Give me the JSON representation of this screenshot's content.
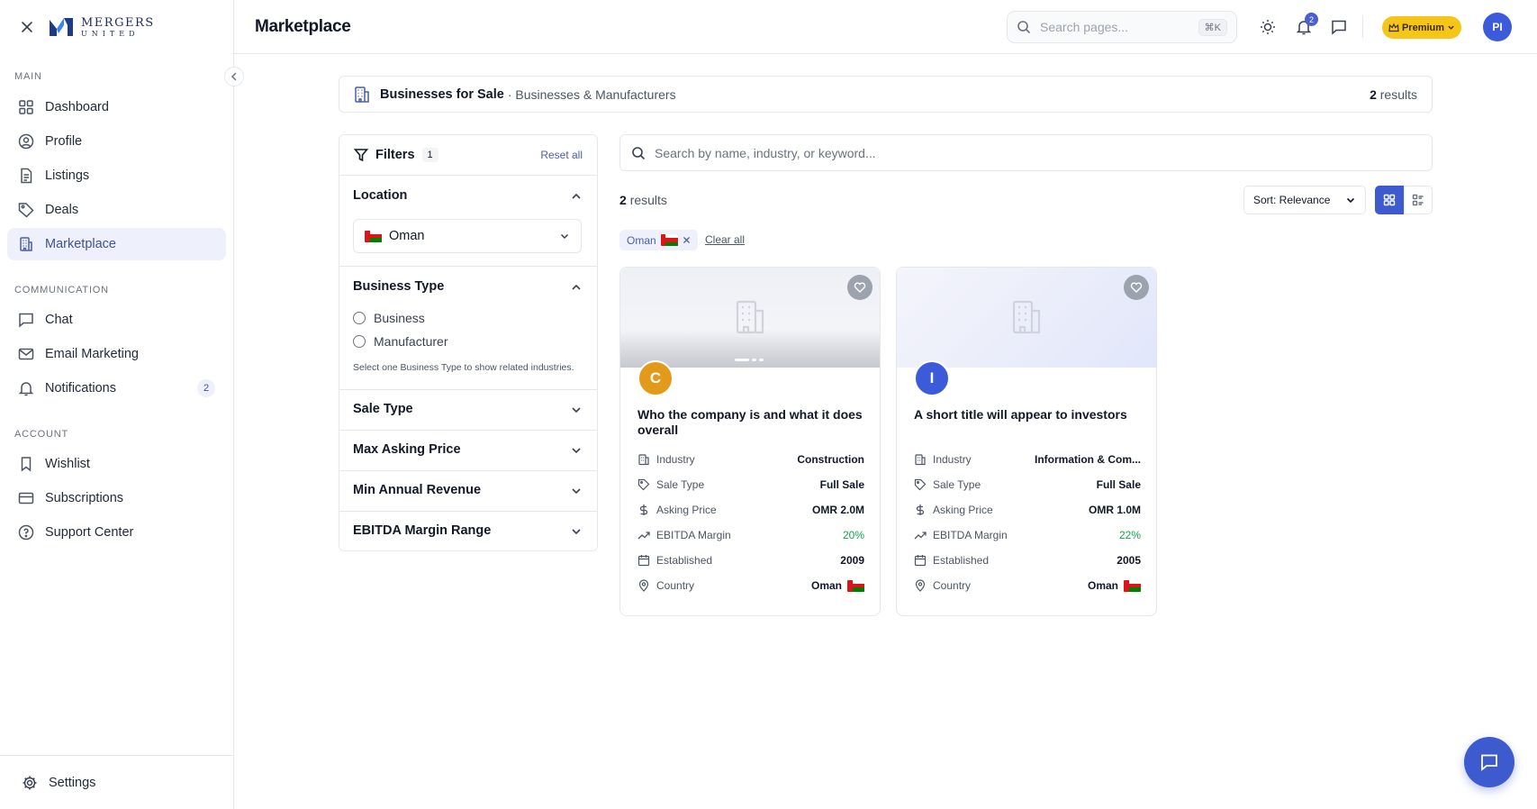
{
  "app": {
    "logo_line1": "MERGERS",
    "logo_line2": "UNITED"
  },
  "sidebar": {
    "sections": {
      "main": "MAIN",
      "communication": "COMMUNICATION",
      "account": "ACCOUNT"
    },
    "items": [
      {
        "label": "Dashboard",
        "icon": "grid-icon"
      },
      {
        "label": "Profile",
        "icon": "user-circle-icon"
      },
      {
        "label": "Listings",
        "icon": "document-icon"
      },
      {
        "label": "Deals",
        "icon": "tag-icon"
      },
      {
        "label": "Marketplace",
        "icon": "building-icon",
        "active": true
      },
      {
        "label": "Chat",
        "icon": "message-icon"
      },
      {
        "label": "Email Marketing",
        "icon": "mail-icon"
      },
      {
        "label": "Notifications",
        "icon": "bell-icon",
        "badge": "2"
      },
      {
        "label": "Wishlist",
        "icon": "bookmark-icon"
      },
      {
        "label": "Subscriptions",
        "icon": "credit-card-icon"
      },
      {
        "label": "Support Center",
        "icon": "help-circle-icon"
      }
    ],
    "footer_label": "Settings"
  },
  "topbar": {
    "title": "Marketplace",
    "search_placeholder": "Search pages...",
    "search_shortcut": "⌘K",
    "notification_count": "2",
    "premium_label": "Premium",
    "avatar_initials": "PI"
  },
  "header_card": {
    "title": "Businesses for Sale",
    "subtitle": "· Businesses & Manufacturers",
    "results_count": "2",
    "results_label": "results"
  },
  "filters": {
    "title": "Filters",
    "active_count": "1",
    "reset_label": "Reset all",
    "location": {
      "title": "Location",
      "selected": "Oman"
    },
    "business_type": {
      "title": "Business Type",
      "options": [
        "Business",
        "Manufacturer"
      ],
      "hint": "Select one Business Type to show related industries."
    },
    "collapsed_sections": [
      "Sale Type",
      "Max Asking Price",
      "Min Annual Revenue",
      "EBITDA Margin Range"
    ]
  },
  "results": {
    "search_placeholder": "Search by name, industry, or keyword...",
    "count": "2",
    "count_label": "results",
    "sort_label": "Sort: Relevance",
    "active_chip": "Oman",
    "clear_all": "Clear all"
  },
  "listings": [
    {
      "initial": "C",
      "avatar_color": "#e39a1b",
      "title": "Who the company is and what it does overall",
      "industry": "Construction",
      "sale_type": "Full Sale",
      "asking_price": "OMR 2.0M",
      "ebitda_margin": "20%",
      "established": "2009",
      "country": "Oman"
    },
    {
      "initial": "I",
      "avatar_color": "#3b5bdb",
      "title": "A short title will appear to investors",
      "industry": "Information & Com...",
      "sale_type": "Full Sale",
      "asking_price": "OMR 1.0M",
      "ebitda_margin": "22%",
      "established": "2005",
      "country": "Oman"
    }
  ],
  "row_labels": {
    "industry": "Industry",
    "sale_type": "Sale Type",
    "asking_price": "Asking Price",
    "ebitda_margin": "EBITDA Margin",
    "established": "Established",
    "country": "Country"
  },
  "colors": {
    "accent": "#3d5bcf",
    "active_nav_bg": "#eef1fb",
    "premium": "#f5c518",
    "positive": "#16a34a"
  }
}
